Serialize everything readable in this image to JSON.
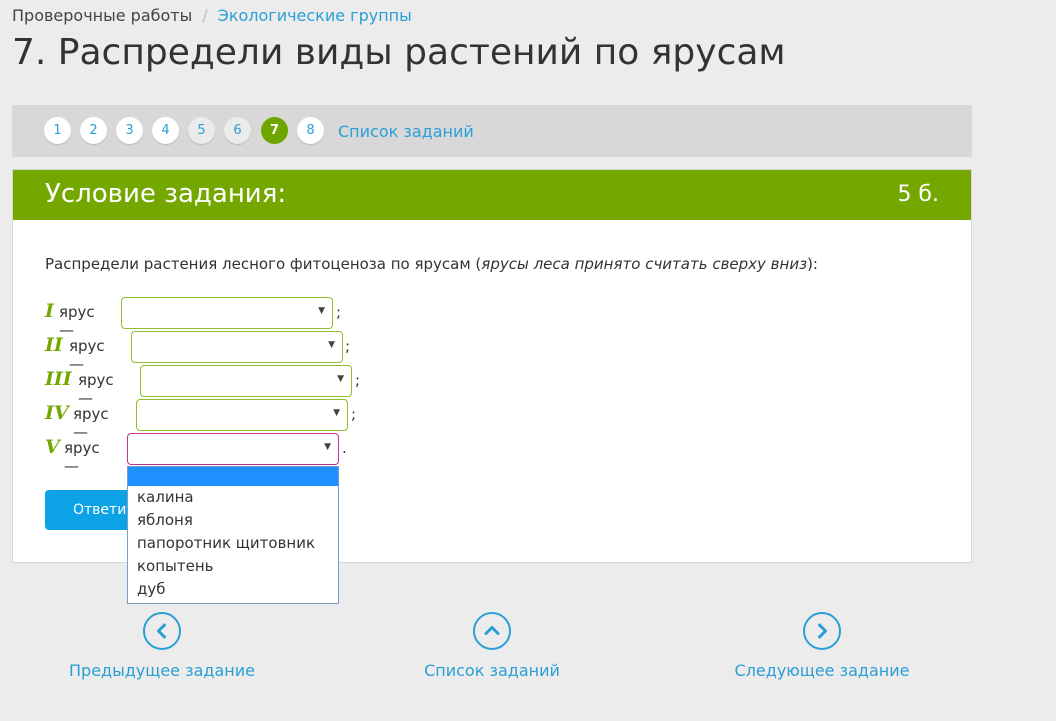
{
  "breadcrumb": {
    "root": "Проверочные работы",
    "separator": "/",
    "current": "Экологические группы"
  },
  "page_title": "7. Распредели виды растений по ярусам",
  "pager": {
    "pages": [
      "1",
      "2",
      "3",
      "4",
      "5",
      "6",
      "7",
      "8"
    ],
    "active_page": "7",
    "tasks_link": "Список заданий"
  },
  "card": {
    "title": "Условие задания:",
    "points": "5 б.",
    "prompt_start": "Распредели растения лесного фитоценоза по ярусам (",
    "prompt_italic": "ярусы леса принято считать сверху вниз",
    "prompt_end": "):",
    "tiers": [
      {
        "roman": "I",
        "word": "ярус —",
        "punct": ";"
      },
      {
        "roman": "II",
        "word": "ярус —",
        "punct": ";"
      },
      {
        "roman": "III",
        "word": "ярус —",
        "punct": ";"
      },
      {
        "roman": "IV",
        "word": "ярус —",
        "punct": ";"
      },
      {
        "roman": "V",
        "word": "ярус —",
        "punct": "."
      }
    ],
    "answer_button": "Ответить"
  },
  "dropdown_options": [
    "",
    "калина",
    "яблоня",
    "папоротник щитовник",
    "копытень",
    "дуб"
  ],
  "nav": {
    "prev": "Предыдущее задание",
    "list": "Список заданий",
    "next": "Следующее задание"
  },
  "colors": {
    "accent_green": "#74a800",
    "link_blue": "#2a9fd6",
    "button_blue": "#0ba3e6"
  },
  "icons": {
    "prev": "chevron-left-icon",
    "list": "chevron-up-icon",
    "next": "chevron-right-icon",
    "select_arrow": "triangle-down-icon"
  }
}
